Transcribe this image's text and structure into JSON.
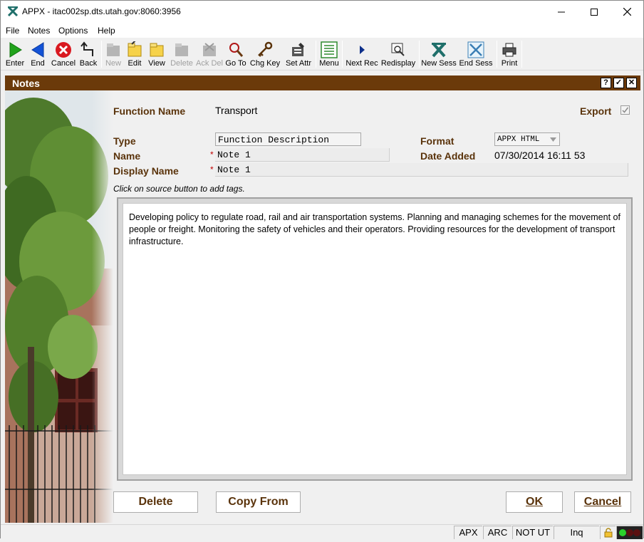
{
  "window": {
    "title": "APPX - itac002sp.dts.utah.gov:8060:3956"
  },
  "menu": [
    "File",
    "Notes",
    "Options",
    "Help"
  ],
  "toolbar": [
    {
      "label": "Enter",
      "icon": "enter-icon",
      "enabled": true
    },
    {
      "label": "End",
      "icon": "end-icon",
      "enabled": true
    },
    {
      "label": "Cancel",
      "icon": "cancel-icon",
      "enabled": true
    },
    {
      "label": "Back",
      "icon": "back-icon",
      "enabled": true
    },
    {
      "label": "New",
      "icon": "new-icon",
      "enabled": false
    },
    {
      "label": "Edit",
      "icon": "edit-icon",
      "enabled": true
    },
    {
      "label": "View",
      "icon": "view-icon",
      "enabled": true
    },
    {
      "label": "Delete",
      "icon": "delete-icon",
      "enabled": false
    },
    {
      "label": "Ack Del",
      "icon": "ack-del-icon",
      "enabled": false
    },
    {
      "label": "Go To",
      "icon": "goto-icon",
      "enabled": true
    },
    {
      "label": "Chg Key",
      "icon": "chg-key-icon",
      "enabled": true
    },
    {
      "label": "Set Attr",
      "icon": "set-attr-icon",
      "enabled": true
    },
    {
      "label": "Menu",
      "icon": "menu-icon",
      "enabled": true
    },
    {
      "label": "Next Rec",
      "icon": "next-rec-icon",
      "enabled": true
    },
    {
      "label": "Redisplay",
      "icon": "redisplay-icon",
      "enabled": true
    },
    {
      "label": "New Sess",
      "icon": "new-sess-icon",
      "enabled": true
    },
    {
      "label": "End Sess",
      "icon": "end-sess-icon",
      "enabled": true
    },
    {
      "label": "Print",
      "icon": "print-icon",
      "enabled": true
    }
  ],
  "panel": {
    "title": "Notes",
    "header_buttons": [
      "?",
      "✓",
      "✕"
    ],
    "function_name_label": "Function Name",
    "function_name_value": "Transport",
    "export_label": "Export",
    "export_checked": true,
    "type_label": "Type",
    "type_value": "Function Description",
    "format_label": "Format",
    "format_value": "APPX HTML",
    "name_label": "Name",
    "name_value": "Note 1",
    "date_added_label": "Date Added",
    "date_added_value": "07/30/2014 16:11 53",
    "display_name_label": "Display Name",
    "display_name_value": "Note 1",
    "required_marker": "*",
    "hint": "Click on source button to add tags.",
    "body_text": "Developing policy to regulate road, rail and air transportation systems. Planning and managing schemes for the movement of people or freight. Monitoring the safety of vehicles and their operators. Providing resources for the development of transport infrastructure.",
    "buttons": {
      "delete": "Delete",
      "copy_from": "Copy From",
      "ok": "OK",
      "cancel": "Cancel"
    }
  },
  "status_bar": [
    "APX",
    "ARC",
    "NOT UT",
    "Inq"
  ],
  "colors": {
    "panel_header": "#6b3a0a",
    "label_brown": "#5a330b",
    "required_red": "#c00000"
  }
}
